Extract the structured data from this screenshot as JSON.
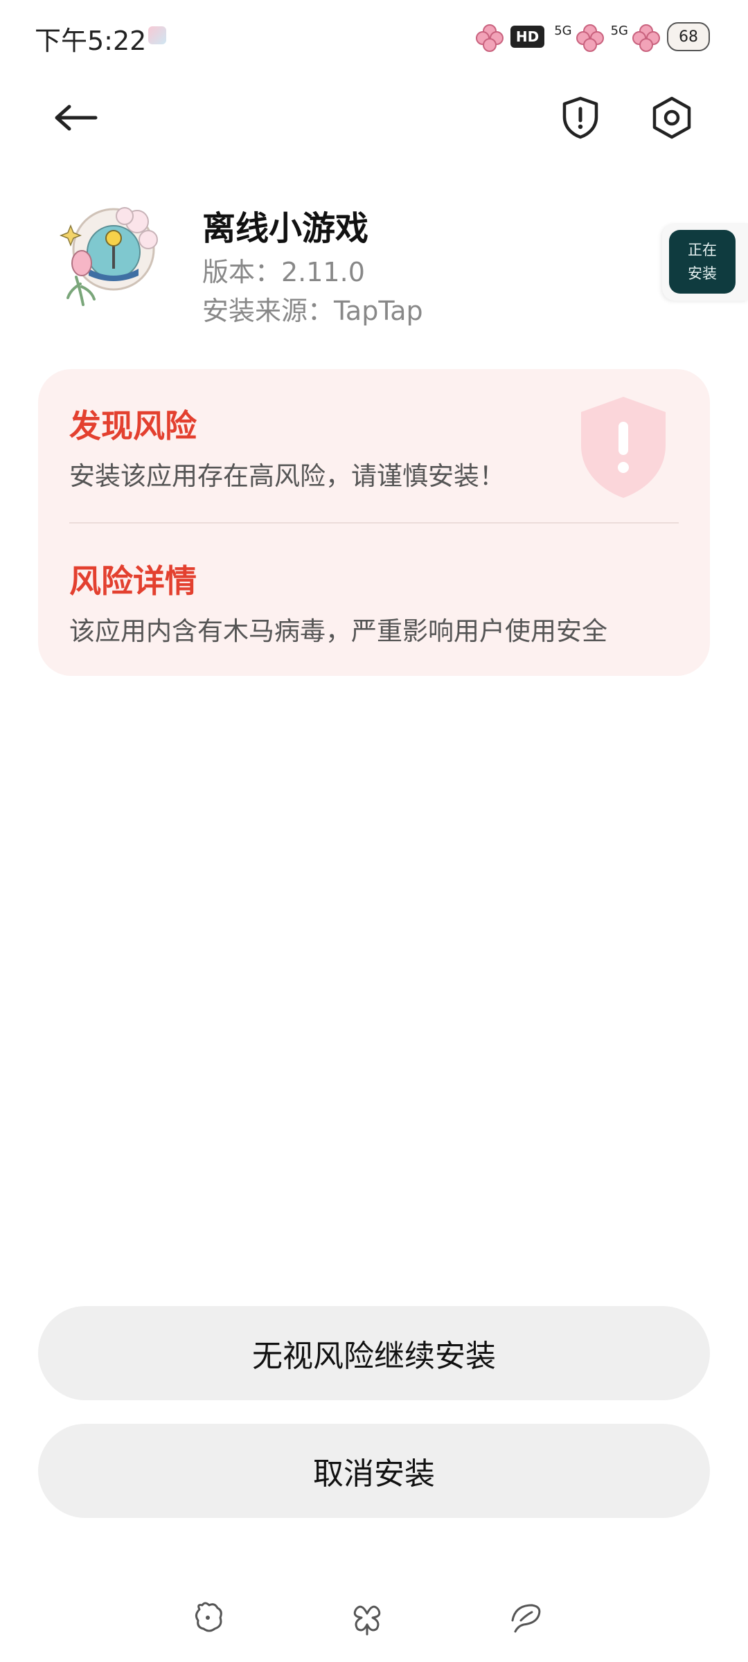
{
  "status_bar": {
    "time": "下午5:22",
    "hd_label": "HD",
    "signal1_label": "5G",
    "signal2_label": "5G",
    "battery": "68"
  },
  "toolbar": {
    "back_icon": "arrow-left-icon",
    "shield_icon": "shield-exclamation-icon",
    "settings_icon": "hexagon-gear-icon"
  },
  "app": {
    "name": "离线小游戏",
    "version": "版本：2.11.0",
    "source": "安装来源：TapTap"
  },
  "floating_chip": {
    "line1": "正在",
    "line2": "安装"
  },
  "risk": {
    "title": "发现风险",
    "description": "安装该应用存在高风险，请谨慎安装！",
    "detail_title": "风险详情",
    "detail_description": "该应用内含有木马病毒，严重影响用户使用安全"
  },
  "actions": {
    "continue_label": "无视风险继续安装",
    "cancel_label": "取消安装"
  },
  "colors": {
    "risk_red": "#e3402f",
    "risk_card_bg": "#fdf1f0",
    "button_bg": "#efefef"
  }
}
